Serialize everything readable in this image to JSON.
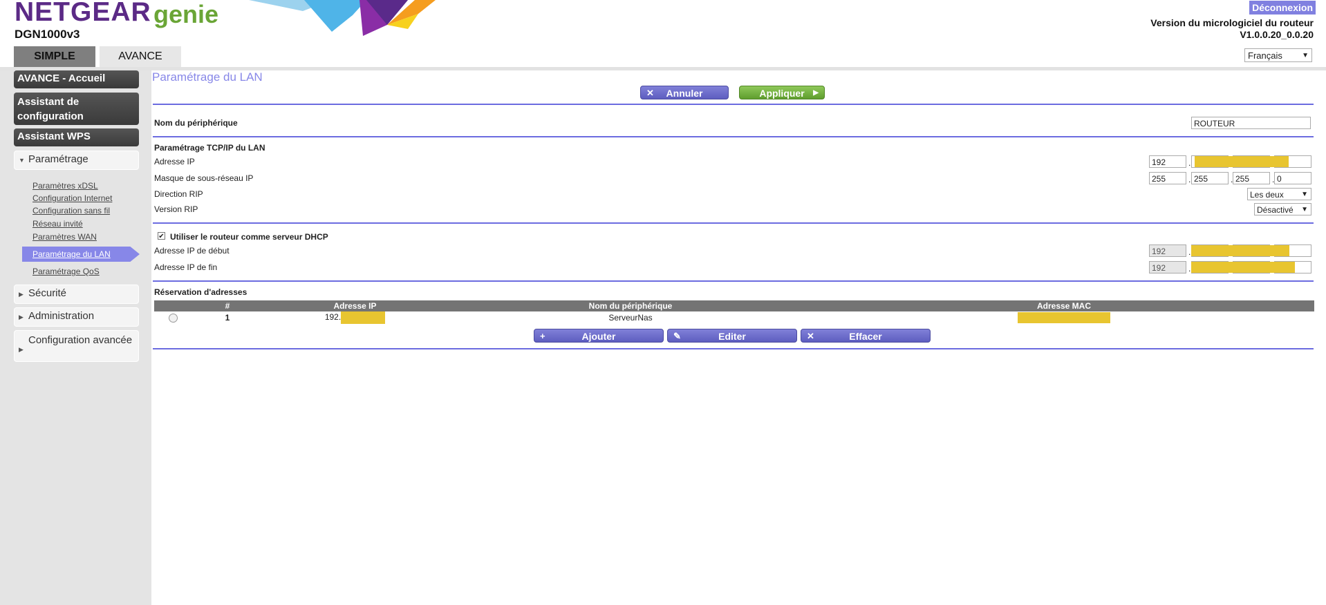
{
  "brand": {
    "name": "NETGEAR",
    "product": "genie",
    "model": "DGN1000v3"
  },
  "header": {
    "logout": "Déconnexion",
    "firmware_label": "Version du micrologiciel du routeur",
    "firmware_version": "V1.0.0.20_0.0.20",
    "tabs": {
      "simple": "SIMPLE",
      "advanced": "AVANCE"
    },
    "language": "Français"
  },
  "sidebar": {
    "home": "AVANCE - Accueil",
    "wizard": "Assistant de configuration",
    "wps": "Assistant WPS",
    "setup": "Paramétrage",
    "setup_links": [
      "Paramètres xDSL",
      "Configuration Internet",
      "Configuration sans fil",
      "Réseau invité",
      "Paramètres WAN"
    ],
    "active": "Paramétrage du LAN",
    "qos": "Paramétrage QoS",
    "security": "Sécurité",
    "administration": "Administration",
    "advanced_config": "Configuration avancée"
  },
  "main": {
    "title": "Paramétrage du LAN",
    "cancel": "Annuler",
    "apply": "Appliquer",
    "device_name_label": "Nom du périphérique",
    "device_name_value": "ROUTEUR",
    "tcpip_heading": "Paramétrage TCP/IP du LAN",
    "ip_label": "Adresse IP",
    "ip": {
      "o1": "192"
    },
    "mask_label": "Masque de sous-réseau IP",
    "mask": {
      "o1": "255",
      "o2": "255",
      "o3": "255",
      "o4": "0"
    },
    "rip_direction_label": "Direction RIP",
    "rip_direction_value": "Les deux",
    "rip_version_label": "Version RIP",
    "rip_version_value": "Désactivé",
    "dhcp_label": "Utiliser le routeur comme serveur DHCP",
    "dhcp_checked": true,
    "start_ip_label": "Adresse IP de début",
    "start_ip_o1": "192",
    "end_ip_label": "Adresse IP de fin",
    "end_ip_o1": "192",
    "reservation_heading": "Réservation d'adresses",
    "table": {
      "headers": [
        "#",
        "Adresse IP",
        "Nom du périphérique",
        "Adresse MAC"
      ],
      "rows": [
        {
          "num": "1",
          "ip": "192.",
          "name": "ServeurNas"
        }
      ]
    },
    "add": "Ajouter",
    "edit": "Editer",
    "delete": "Effacer"
  },
  "colors": {
    "accent": "#8787e8",
    "brand_purple": "#5b2a86",
    "brand_green": "#6aa536",
    "redaction": "#e8c530"
  }
}
